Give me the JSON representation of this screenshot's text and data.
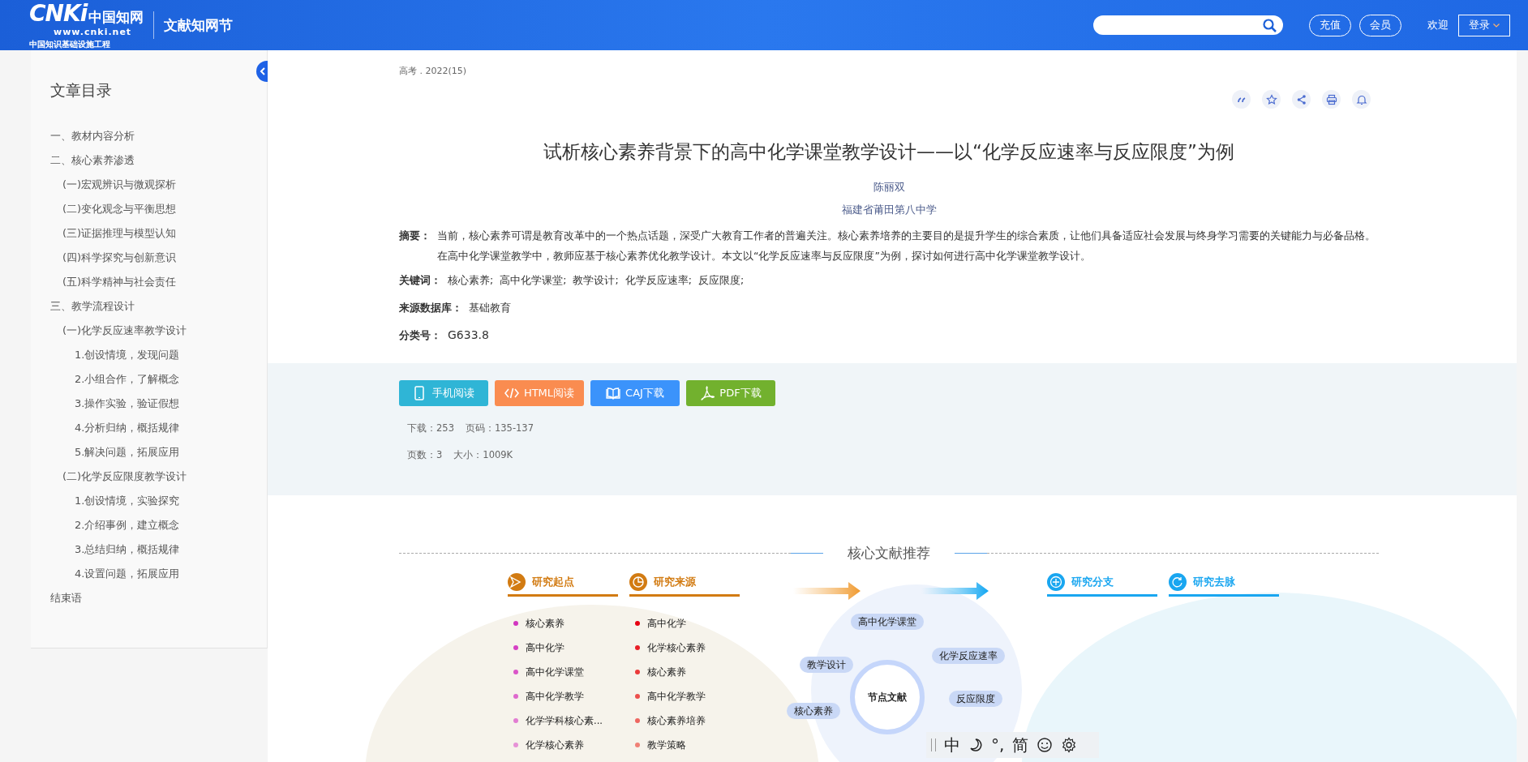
{
  "header": {
    "logo_mark": "CNKi",
    "logo_name": "中国知网",
    "logo_url": "www.cnki.net",
    "logo_subtitle": "中国知识基础设施工程",
    "product": "文献知网节",
    "buttons": [
      "充值",
      "会员"
    ],
    "welcome": "欢迎",
    "login": "登录"
  },
  "toc": {
    "title": "文章目录",
    "items": [
      {
        "label": "一、教材内容分析"
      },
      {
        "label": "二、核心素养渗透",
        "children": [
          {
            "label": "(一)宏观辨识与微观探析"
          },
          {
            "label": "(二)变化观念与平衡思想"
          },
          {
            "label": "(三)证据推理与模型认知"
          },
          {
            "label": "(四)科学探究与创新意识"
          },
          {
            "label": "(五)科学精神与社会责任"
          }
        ]
      },
      {
        "label": "三、教学流程设计",
        "children": [
          {
            "label": "(一)化学反应速率教学设计",
            "children": [
              {
                "label": "1.创设情境，发现问题"
              },
              {
                "label": "2.小组合作，了解概念"
              },
              {
                "label": "3.操作实验，验证假想"
              },
              {
                "label": "4.分析归纳，概括规律"
              },
              {
                "label": "5.解决问题，拓展应用"
              }
            ]
          },
          {
            "label": "(二)化学反应限度教学设计",
            "children": [
              {
                "label": "1.创设情境，实验探究"
              },
              {
                "label": "2.介绍事例，建立概念"
              },
              {
                "label": "3.总结归纳，概括规律"
              },
              {
                "label": "4.设置问题，拓展应用"
              }
            ]
          }
        ]
      },
      {
        "label": "结束语"
      }
    ]
  },
  "article": {
    "source": "高考 . 2022(15)",
    "title": "试析核心素养背景下的高中化学课堂教学设计——以“化学反应速率与反应限度”为例",
    "author": "陈丽双",
    "affiliation": "福建省莆田第八中学",
    "abstract": {
      "label": "摘要：",
      "text": "当前，核心素养可谓是教育改革中的一个热点话题，深受广大教育工作者的普遍关注。核心素养培养的主要目的是提升学生的综合素质，让他们具备适应社会发展与终身学习需要的关键能力与必备品格。在高中化学课堂教学中，教师应基于核心素养优化教学设计。本文以“化学反应速率与反应限度”为例，探讨如何进行高中化学课堂教学设计。"
    },
    "keywords": {
      "label": "关键词：",
      "items": [
        "核心素养;",
        "高中化学课堂;",
        "教学设计;",
        "化学反应速率;",
        "反应限度;"
      ]
    },
    "database": {
      "label": "来源数据库：",
      "value": "基础教育"
    },
    "classification": {
      "label": "分类号：",
      "value": "G633.8"
    }
  },
  "downloads": {
    "buttons": [
      {
        "label": "手机阅读",
        "kind": "mobile",
        "color": "#2fb5d6"
      },
      {
        "label": "HTML阅读",
        "kind": "html",
        "color": "#fa8c50"
      },
      {
        "label": "CAJ下载",
        "kind": "caj",
        "color": "#3b93fb"
      },
      {
        "label": "PDF下载",
        "kind": "pdf",
        "color": "#72b12e"
      }
    ],
    "stats": [
      [
        "下载：253",
        "页码：135-137"
      ],
      [
        "页数：3",
        "大小：1009K"
      ]
    ]
  },
  "recommend": {
    "title": "核心文献推荐",
    "columns": [
      {
        "title": "研究起点",
        "kind": "start",
        "items": [
          {
            "label": "核心素养",
            "color": "#d236c0"
          },
          {
            "label": "高中化学",
            "color": "#d640c4"
          },
          {
            "label": "高中化学课堂",
            "color": "#da55c9"
          },
          {
            "label": "高中化学教学",
            "color": "#de69cd"
          },
          {
            "label": "化学学科核心素...",
            "color": "#e27dd2"
          },
          {
            "label": "化学核心素养",
            "color": "#e692d6"
          }
        ]
      },
      {
        "title": "研究来源",
        "kind": "source",
        "items": [
          {
            "label": "高中化学",
            "color": "#e60012"
          },
          {
            "label": "化学核心素养",
            "color": "#e81e26"
          },
          {
            "label": "核心素养",
            "color": "#ea3a3a"
          },
          {
            "label": "高中化学教学",
            "color": "#ec4f4c"
          },
          {
            "label": "核心素养培养",
            "color": "#ee6660"
          },
          {
            "label": "教学策略",
            "color": "#f08076"
          }
        ]
      }
    ],
    "center": "节点文献",
    "nodes": [
      "高中化学课堂",
      "教学设计",
      "化学反应速率",
      "反应限度",
      "核心素养"
    ],
    "branches": [
      {
        "title": "研究分支",
        "kind": "branch"
      },
      {
        "title": "研究去脉",
        "kind": "trend"
      }
    ]
  },
  "ime": [
    "中",
    "°,",
    "简"
  ]
}
